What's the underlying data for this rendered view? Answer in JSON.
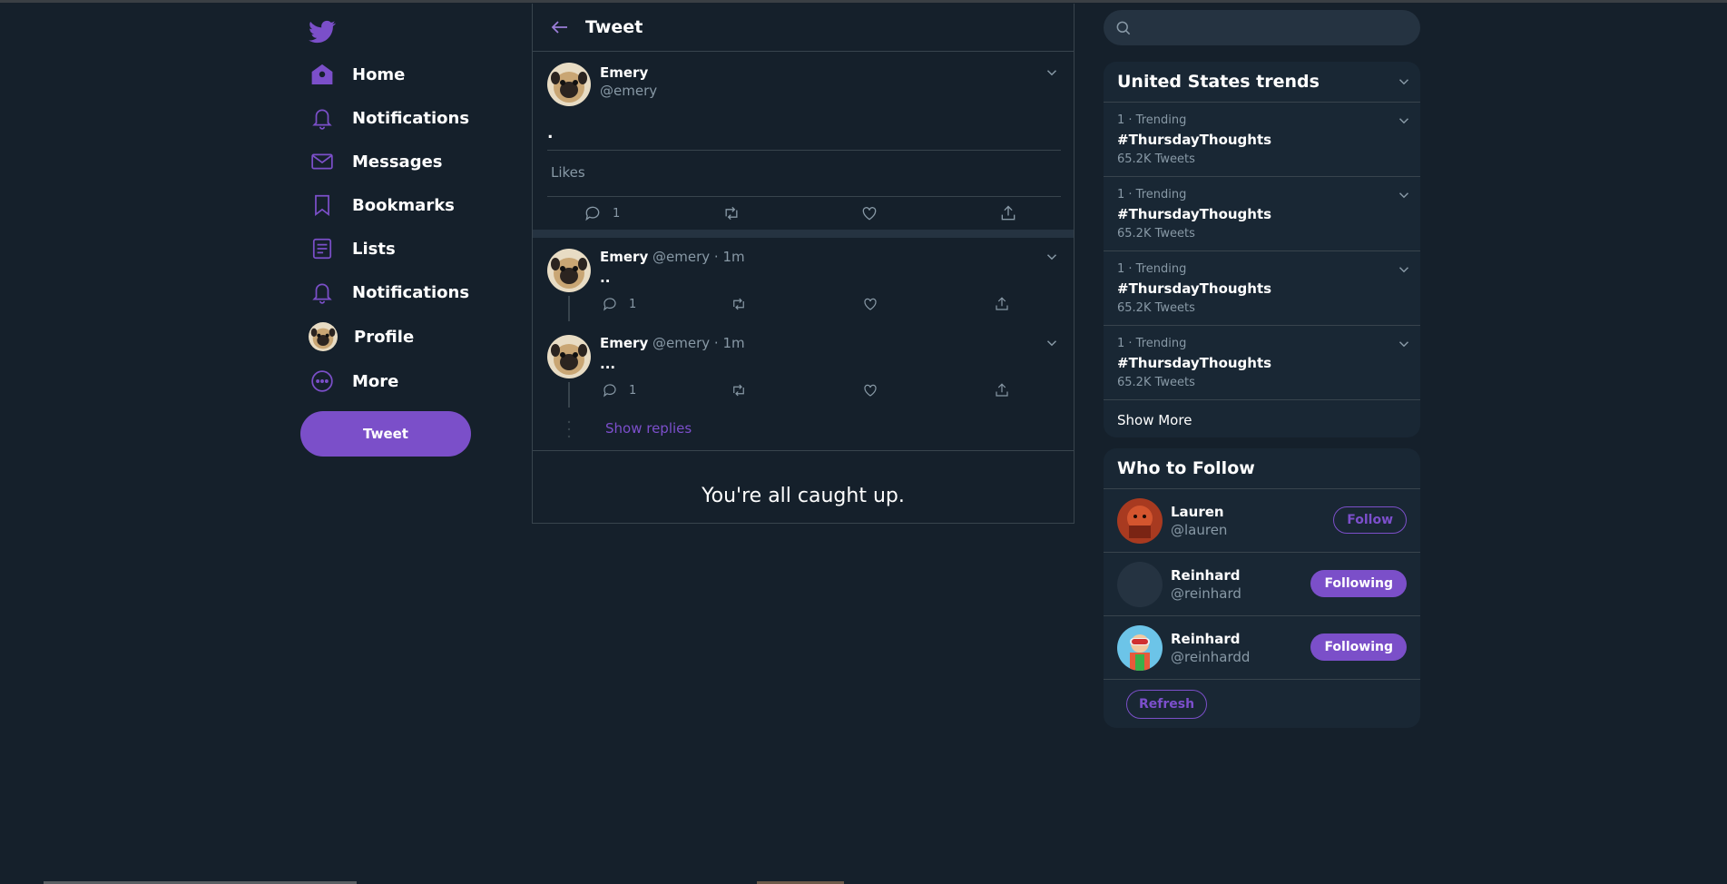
{
  "colors": {
    "background": "#15202b",
    "accent": "#7b4fc9",
    "card": "#192734",
    "muted": "#8899a6",
    "border": "#38444d"
  },
  "sidebar": {
    "logo_icon": "bird-icon",
    "items": [
      {
        "label": "Home",
        "icon": "home-icon"
      },
      {
        "label": "Notifications",
        "icon": "bell-icon"
      },
      {
        "label": "Messages",
        "icon": "envelope-icon"
      },
      {
        "label": "Bookmarks",
        "icon": "bookmark-icon"
      },
      {
        "label": "Lists",
        "icon": "list-icon"
      },
      {
        "label": "Notifications",
        "icon": "bell-icon"
      },
      {
        "label": "Profile",
        "icon": "avatar"
      },
      {
        "label": "More",
        "icon": "more-icon"
      }
    ],
    "tweet_button": "Tweet"
  },
  "main": {
    "title": "Tweet",
    "focus_tweet": {
      "name": "Emery",
      "handle": "@emery",
      "text": ".",
      "likes_label": "Likes",
      "reply_count": "1"
    },
    "replies": [
      {
        "name": "Emery",
        "handle": "@emery",
        "time": "1m",
        "text": "..",
        "reply_count": "1"
      },
      {
        "name": "Emery",
        "handle": "@emery",
        "time": "1m",
        "text": "...",
        "reply_count": "1"
      }
    ],
    "show_replies": "Show replies",
    "caught_up": "You're all caught up."
  },
  "right": {
    "search": {
      "placeholder": "",
      "value": ""
    },
    "trends": {
      "title": "United States trends",
      "items": [
        {
          "meta": "1 · Trending",
          "tag": "#ThursdayThoughts",
          "count": "65.2K Tweets"
        },
        {
          "meta": "1 · Trending",
          "tag": "#ThursdayThoughts",
          "count": "65.2K Tweets"
        },
        {
          "meta": "1 · Trending",
          "tag": "#ThursdayThoughts",
          "count": "65.2K Tweets"
        },
        {
          "meta": "1 · Trending",
          "tag": "#ThursdayThoughts",
          "count": "65.2K Tweets"
        }
      ],
      "show_more": "Show More"
    },
    "who_to_follow": {
      "title": "Who to Follow",
      "users": [
        {
          "name": "Lauren",
          "handle": "@lauren",
          "button": "Follow"
        },
        {
          "name": "Reinhard",
          "handle": "@reinhard",
          "button": "Following"
        },
        {
          "name": "Reinhard",
          "handle": "@reinhardd",
          "button": "Following"
        }
      ],
      "refresh": "Refresh"
    }
  }
}
